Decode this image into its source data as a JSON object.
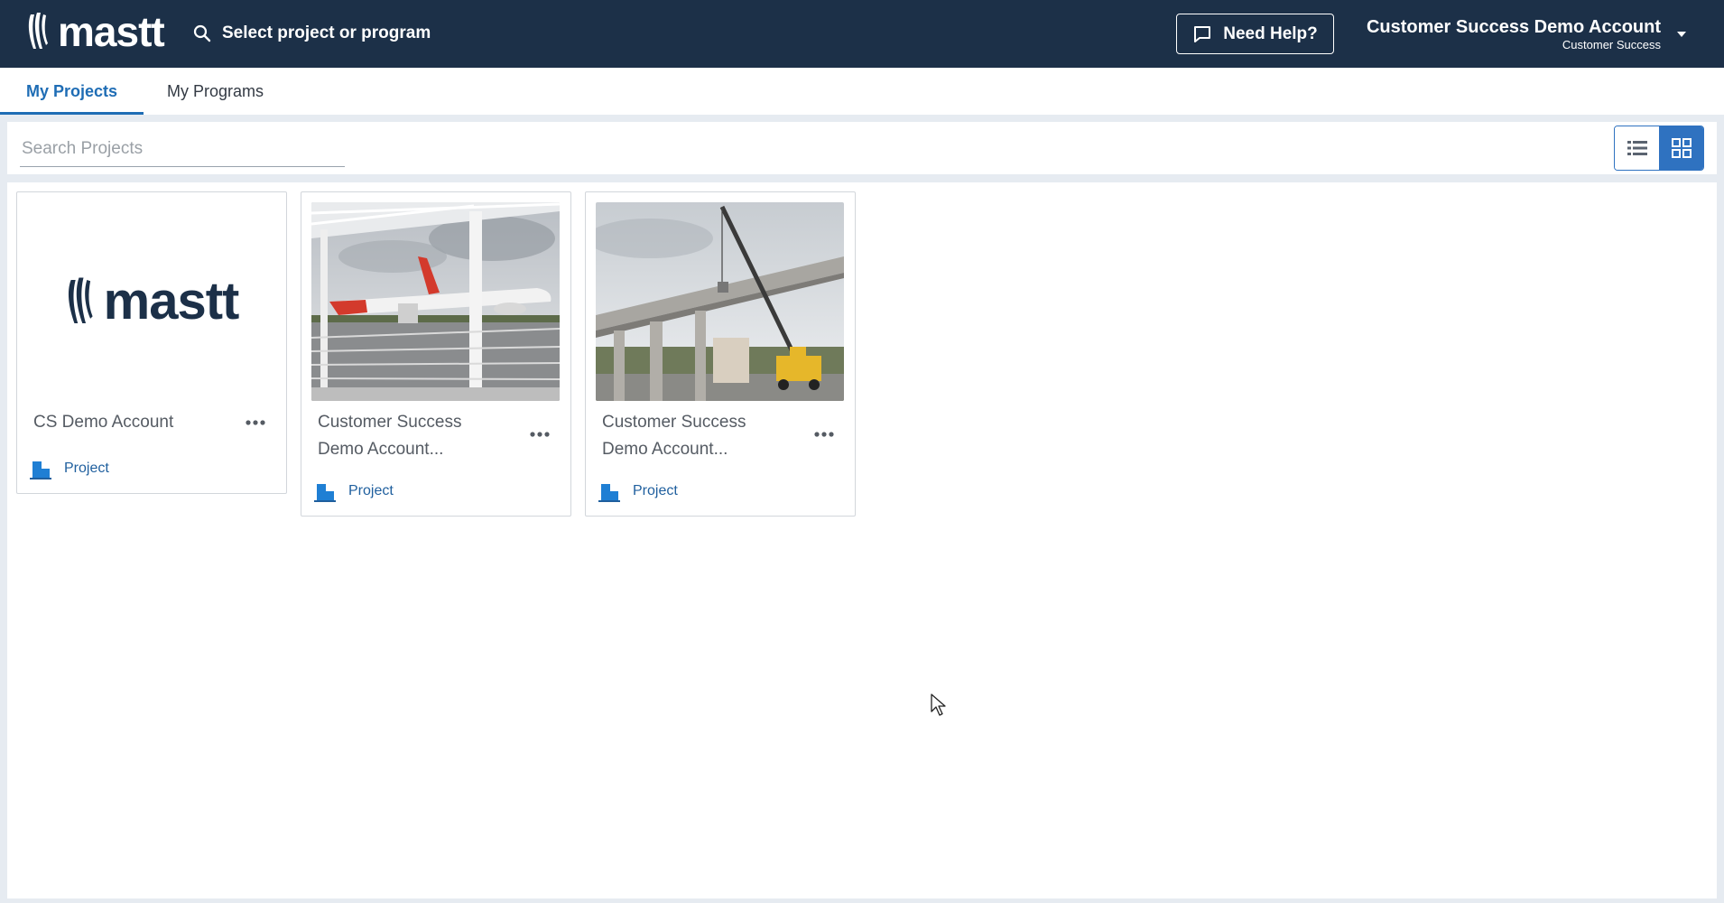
{
  "header": {
    "logo_text": "mastt",
    "global_search": "Select project or program",
    "help_label": "Need Help?",
    "account_name": "Customer Success Demo Account",
    "account_role": "Customer Success"
  },
  "tabs": [
    {
      "label": "My Projects",
      "active": true
    },
    {
      "label": "My Programs",
      "active": false
    }
  ],
  "search": {
    "placeholder": "Search Projects",
    "value": ""
  },
  "view_toggle": {
    "options": [
      "list-icon",
      "grid-icon"
    ],
    "active": "grid-icon"
  },
  "projects": [
    {
      "title": "CS Demo Account",
      "type": "Project",
      "thumbnail": "mastt-logo"
    },
    {
      "title_line1": "Customer Success",
      "title_line2": "Demo Account...",
      "type": "Project",
      "thumbnail": "airport-photo"
    },
    {
      "title_line1": "Customer Success",
      "title_line2": "Demo Account...",
      "type": "Project",
      "thumbnail": "crane-bridge-photo"
    }
  ],
  "colors": {
    "header_bg": "#1c3048",
    "accent": "#1f6db5",
    "toggle_active": "#2f72c0"
  }
}
